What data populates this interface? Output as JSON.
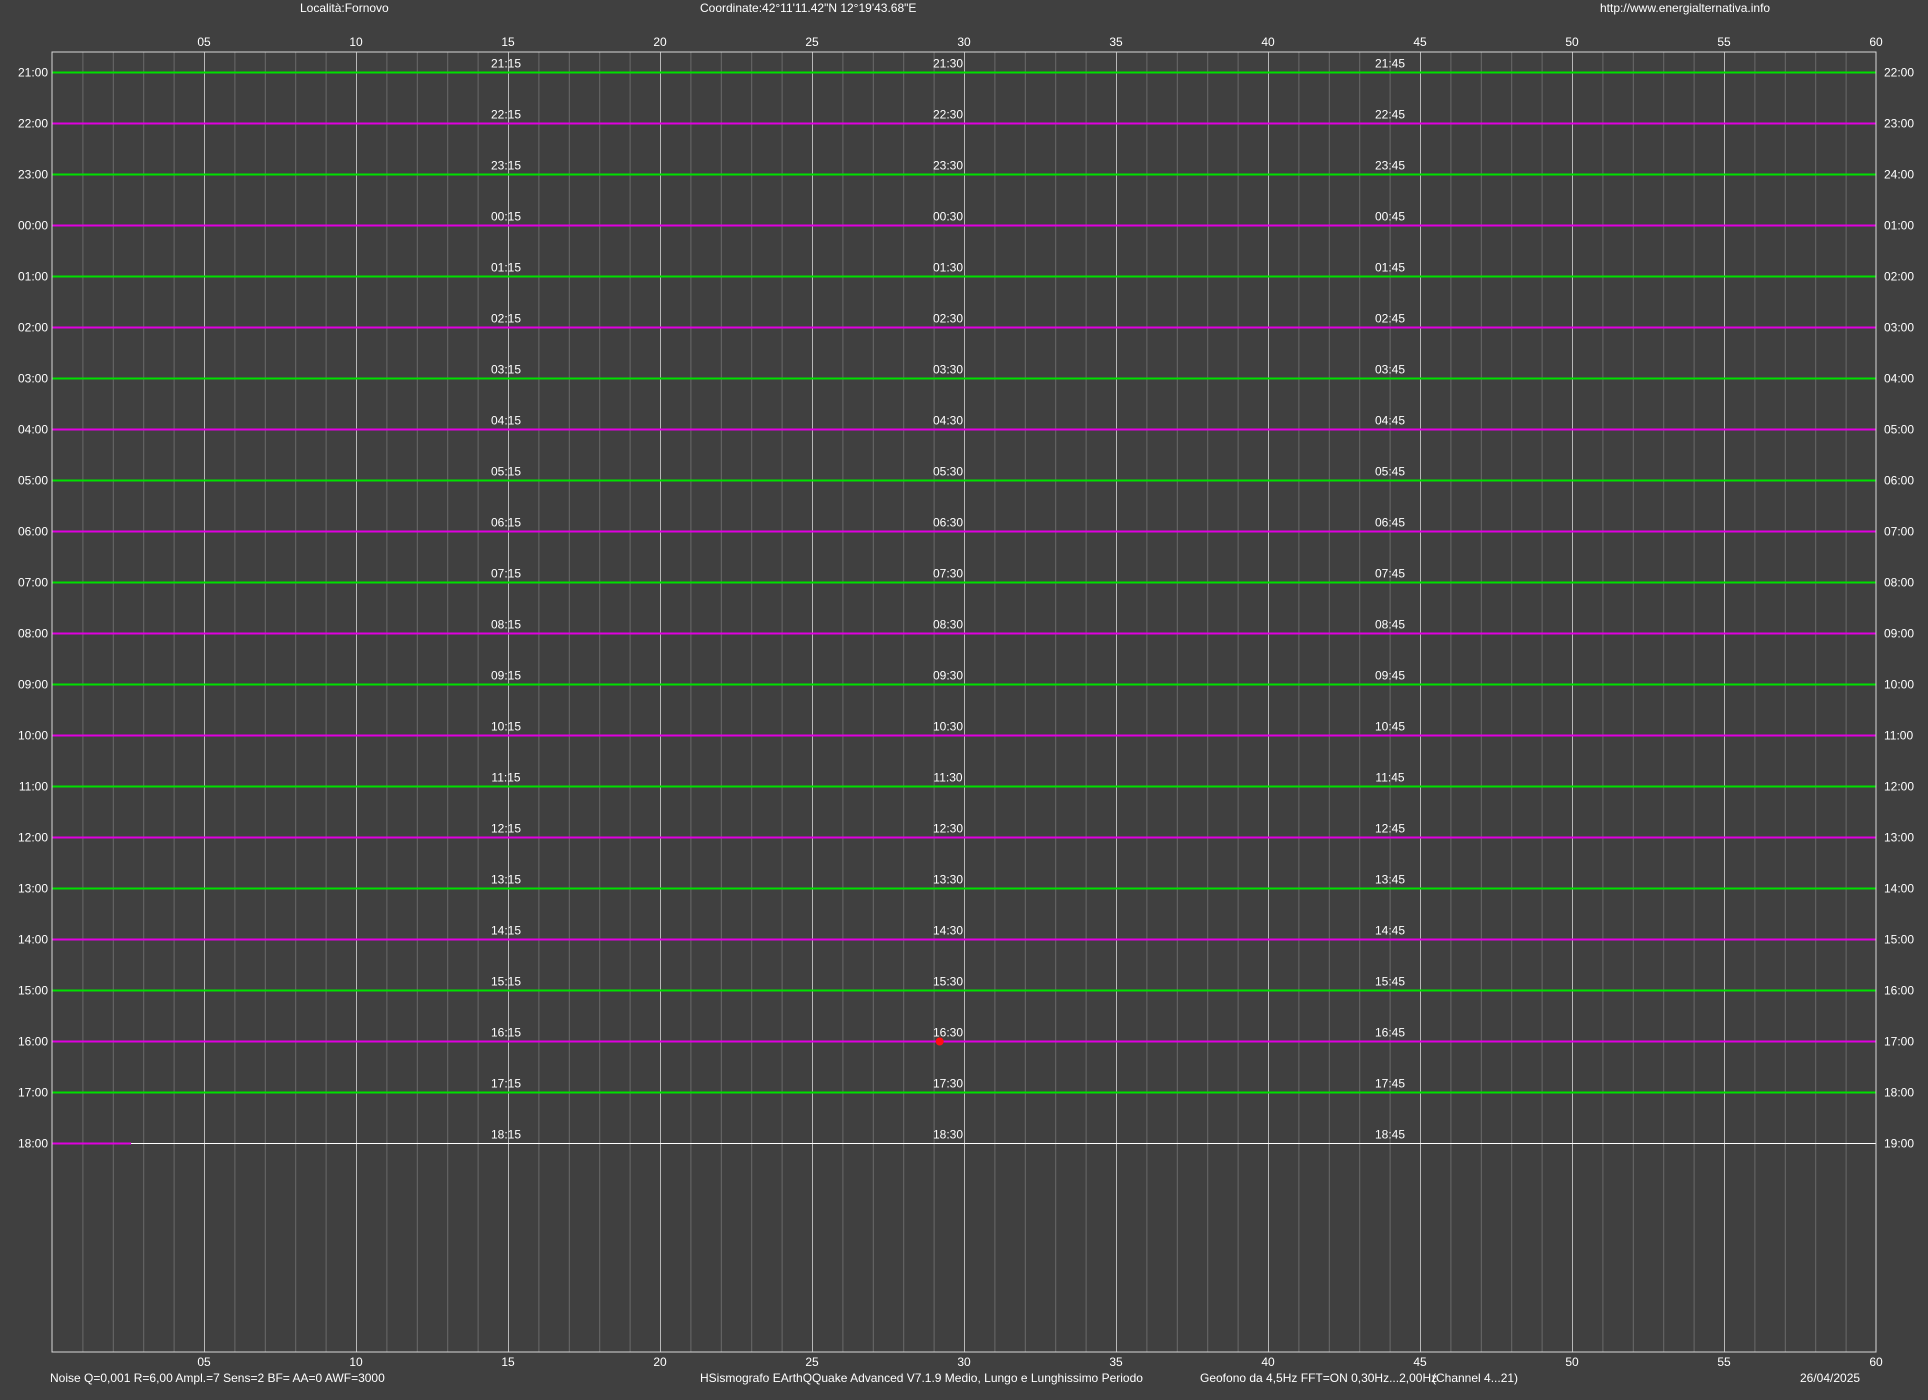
{
  "header": {
    "location": "Località:Fornovo",
    "coordinates": "Coordinate:42°11'11.42\"N  12°19'43.68\"E",
    "url": "http://www.energialternativa.info"
  },
  "footer": {
    "noise": "Noise Q=0,001 R=6,00 Ampl.=7 Sens=2 BF= AA=0 AWF=3000",
    "software": "HSismografo  EArthQQuake Advanced V7.1.9  Medio, Lungo e Lunghissimo Periodo",
    "sensor": "Geofono da 4,5Hz FFT=ON 0,30Hz...2,00Hz",
    "channel": "(Channel 4...21)",
    "date": "26/04/2025"
  },
  "colors": {
    "background": "#404040",
    "frame": "#d8d8d8",
    "major_grid": "#b8b8b8",
    "minor_grid": "#6a6a6a",
    "trace_green": "#00e000",
    "trace_magenta": "#e000e0",
    "trace_last": "#ffffff",
    "event_marker": "#ff1010"
  },
  "chart_data": {
    "type": "line",
    "x_axis": {
      "range": [
        0,
        60
      ],
      "major_ticks": [
        5,
        10,
        15,
        20,
        25,
        30,
        35,
        40,
        45,
        50,
        55,
        60
      ],
      "tick_labels": [
        "05",
        "10",
        "15",
        "20",
        "25",
        "30",
        "35",
        "40",
        "45",
        "50",
        "55",
        "60"
      ],
      "minor_step": 1
    },
    "rows": [
      {
        "left": "21:00",
        "right": "22:00",
        "q1": "21:15",
        "q2": "21:30",
        "q3": "21:45",
        "color": "green"
      },
      {
        "left": "22:00",
        "right": "23:00",
        "q1": "22:15",
        "q2": "22:30",
        "q3": "22:45",
        "color": "magenta"
      },
      {
        "left": "23:00",
        "right": "24:00",
        "q1": "23:15",
        "q2": "23:30",
        "q3": "23:45",
        "color": "green"
      },
      {
        "left": "00:00",
        "right": "01:00",
        "q1": "00:15",
        "q2": "00:30",
        "q3": "00:45",
        "color": "magenta"
      },
      {
        "left": "01:00",
        "right": "02:00",
        "q1": "01:15",
        "q2": "01:30",
        "q3": "01:45",
        "color": "green"
      },
      {
        "left": "02:00",
        "right": "03:00",
        "q1": "02:15",
        "q2": "02:30",
        "q3": "02:45",
        "color": "magenta"
      },
      {
        "left": "03:00",
        "right": "04:00",
        "q1": "03:15",
        "q2": "03:30",
        "q3": "03:45",
        "color": "green"
      },
      {
        "left": "04:00",
        "right": "05:00",
        "q1": "04:15",
        "q2": "04:30",
        "q3": "04:45",
        "color": "magenta"
      },
      {
        "left": "05:00",
        "right": "06:00",
        "q1": "05:15",
        "q2": "05:30",
        "q3": "05:45",
        "color": "green"
      },
      {
        "left": "06:00",
        "right": "07:00",
        "q1": "06:15",
        "q2": "06:30",
        "q3": "06:45",
        "color": "magenta"
      },
      {
        "left": "07:00",
        "right": "08:00",
        "q1": "07:15",
        "q2": "07:30",
        "q3": "07:45",
        "color": "green"
      },
      {
        "left": "08:00",
        "right": "09:00",
        "q1": "08:15",
        "q2": "08:30",
        "q3": "08:45",
        "color": "magenta"
      },
      {
        "left": "09:00",
        "right": "10:00",
        "q1": "09:15",
        "q2": "09:30",
        "q3": "09:45",
        "color": "green"
      },
      {
        "left": "10:00",
        "right": "11:00",
        "q1": "10:15",
        "q2": "10:30",
        "q3": "10:45",
        "color": "magenta"
      },
      {
        "left": "11:00",
        "right": "12:00",
        "q1": "11:15",
        "q2": "11:30",
        "q3": "11:45",
        "color": "green"
      },
      {
        "left": "12:00",
        "right": "13:00",
        "q1": "12:15",
        "q2": "12:30",
        "q3": "12:45",
        "color": "magenta"
      },
      {
        "left": "13:00",
        "right": "14:00",
        "q1": "13:15",
        "q2": "13:30",
        "q3": "13:45",
        "color": "green"
      },
      {
        "left": "14:00",
        "right": "15:00",
        "q1": "14:15",
        "q2": "14:30",
        "q3": "14:45",
        "color": "magenta"
      },
      {
        "left": "15:00",
        "right": "16:00",
        "q1": "15:15",
        "q2": "15:30",
        "q3": "15:45",
        "color": "green"
      },
      {
        "left": "16:00",
        "right": "17:00",
        "q1": "16:15",
        "q2": "16:30",
        "q3": "16:45",
        "color": "magenta"
      },
      {
        "left": "17:00",
        "right": "18:00",
        "q1": "17:15",
        "q2": "17:30",
        "q3": "17:45",
        "color": "green"
      },
      {
        "left": "18:00",
        "right": "19:00",
        "q1": "18:15",
        "q2": "18:30",
        "q3": "18:45",
        "color": "white"
      }
    ],
    "last_row_recorded_until_minute": 2.6,
    "events": [
      {
        "row": "16:00",
        "minute": 29.2
      }
    ]
  }
}
